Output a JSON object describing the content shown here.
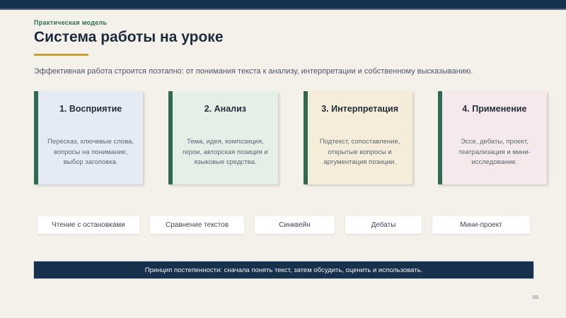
{
  "slide": {
    "kicker": "Практическая модель",
    "title": "Система работы на уроке",
    "subtitle": "Эффективная работа строится поэтапно: от понимания текста к анализу, интерпретации и собственному высказыванию.",
    "page_number": "05"
  },
  "cards": [
    {
      "title": "1. Восприятие",
      "body": "Пересказ, ключевые слова, вопросы на понимание, выбор заголовка.",
      "bg": "#e4ebf4"
    },
    {
      "title": "2. Анализ",
      "body": "Тема, идея, композиция, герои, авторская позиция и языковые средства.",
      "bg": "#e4efe7"
    },
    {
      "title": "3. Интерпретация",
      "body": "Подтекст, сопоставление, открытые вопросы и аргументация позиции.",
      "bg": "#f5edd9"
    },
    {
      "title": "4. Применение",
      "body": "Эссе, дебаты, проект, театрализация и мини-исследование.",
      "bg": "#f6e9eb"
    }
  ],
  "pills": [
    {
      "label": "Чтение с остановками"
    },
    {
      "label": "Сравнение текстов"
    },
    {
      "label": "Синквейн"
    },
    {
      "label": "Дебаты"
    },
    {
      "label": "Мини-проект"
    }
  ],
  "banner": {
    "text": "Принцип постепенности: сначала понять текст, затем обсудить, оценить и использовать."
  },
  "colors": {
    "navy": "#17304b",
    "green": "#2f6b51",
    "gold": "#c9a13b",
    "background": "#f4f1ea",
    "card_blue": "#e4ebf4",
    "card_green": "#e4efe7",
    "card_sand": "#f5edd9",
    "card_pink": "#f6e9eb"
  }
}
